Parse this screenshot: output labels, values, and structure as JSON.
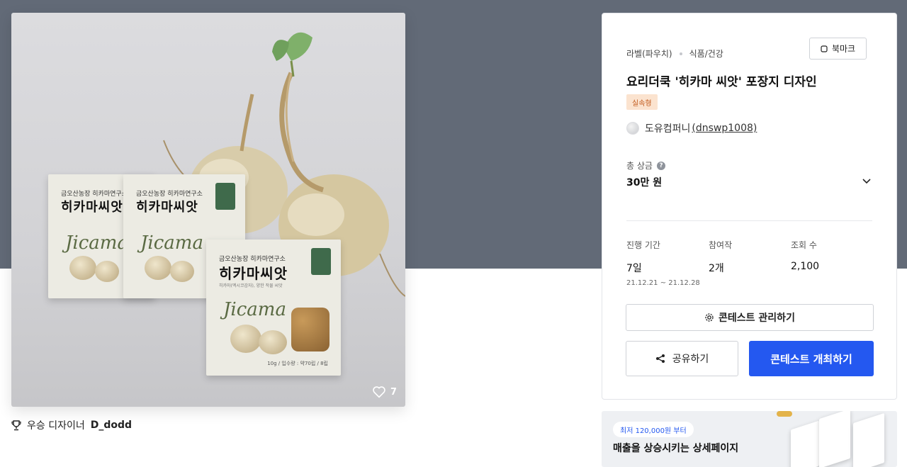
{
  "product": {
    "like_count": "7",
    "pouch": {
      "farm_text": "금오산농장 히카마연구소",
      "title": "히카마씨앗",
      "sub_text": "히카마(멕시코감자), 양한 작물 씨앗",
      "script_text": "Jicama",
      "weight_text": "10g / 입수량 : 약70립 / 8립"
    }
  },
  "winner": {
    "label": "우승 디자이너",
    "name": "D_dodd"
  },
  "panel": {
    "category_main": "라벨(파우치)",
    "category_sub": "식품/건강",
    "bookmark_label": "북마크",
    "title": "요리더쿡 '히카마 씨앗' 포장지 디자인",
    "type_badge": "실속형",
    "host_name": "도유컴퍼니",
    "host_handle": "(dnswp1008)",
    "prize_label": "총 상금",
    "help_glyph": "?",
    "prize_value": "30만 원",
    "stats": [
      {
        "label": "진행 기간",
        "value": "7일",
        "range": "21.12.21 ~ 21.12.28"
      },
      {
        "label": "참여작",
        "value": "2개"
      },
      {
        "label": "조회 수",
        "value": "2,100"
      }
    ],
    "manage_label": "콘테스트 관리하기",
    "share_label": "공유하기",
    "host_contest_label": "콘테스트 개최하기"
  },
  "ad": {
    "price_tag": "최저 120,000원 부터",
    "headline": "매출을 상승시키는 상세페이지"
  },
  "colors": {
    "hero_bg": "#626a77",
    "primary": "#2458f0",
    "badge_bg": "#fbe3cf",
    "badge_text": "#c25a1d"
  },
  "icons": [
    "heart-icon",
    "trophy-icon",
    "bookmark-icon",
    "help-icon",
    "chevron-down-icon",
    "gear-icon",
    "share-icon"
  ]
}
